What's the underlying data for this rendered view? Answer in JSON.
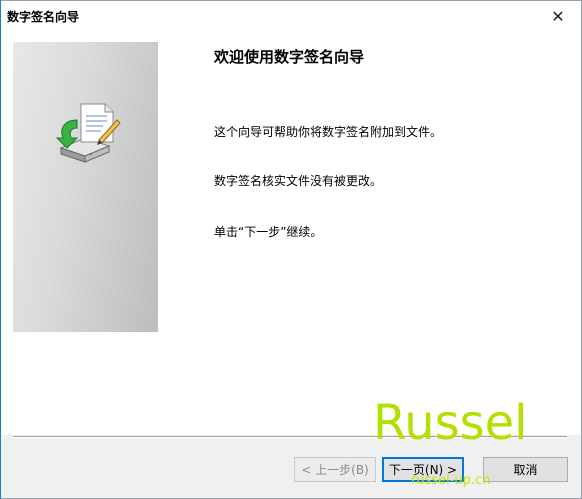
{
  "window": {
    "title": "数字签名向导",
    "close_label": "✕"
  },
  "main": {
    "heading": "欢迎使用数字签名向导",
    "paragraphs": [
      "这个向导可帮助你将数字签名附加到文件。",
      "数字签名核实文件没有被更改。",
      "单击“下一步”继续。"
    ]
  },
  "buttons": {
    "back": "< 上一步(B)",
    "next": "下一页(N) >",
    "cancel": "取消"
  },
  "watermark": {
    "name": "Russel",
    "url": "russel-up.cn"
  },
  "icons": {
    "wizard": "certificate-download-icon"
  }
}
